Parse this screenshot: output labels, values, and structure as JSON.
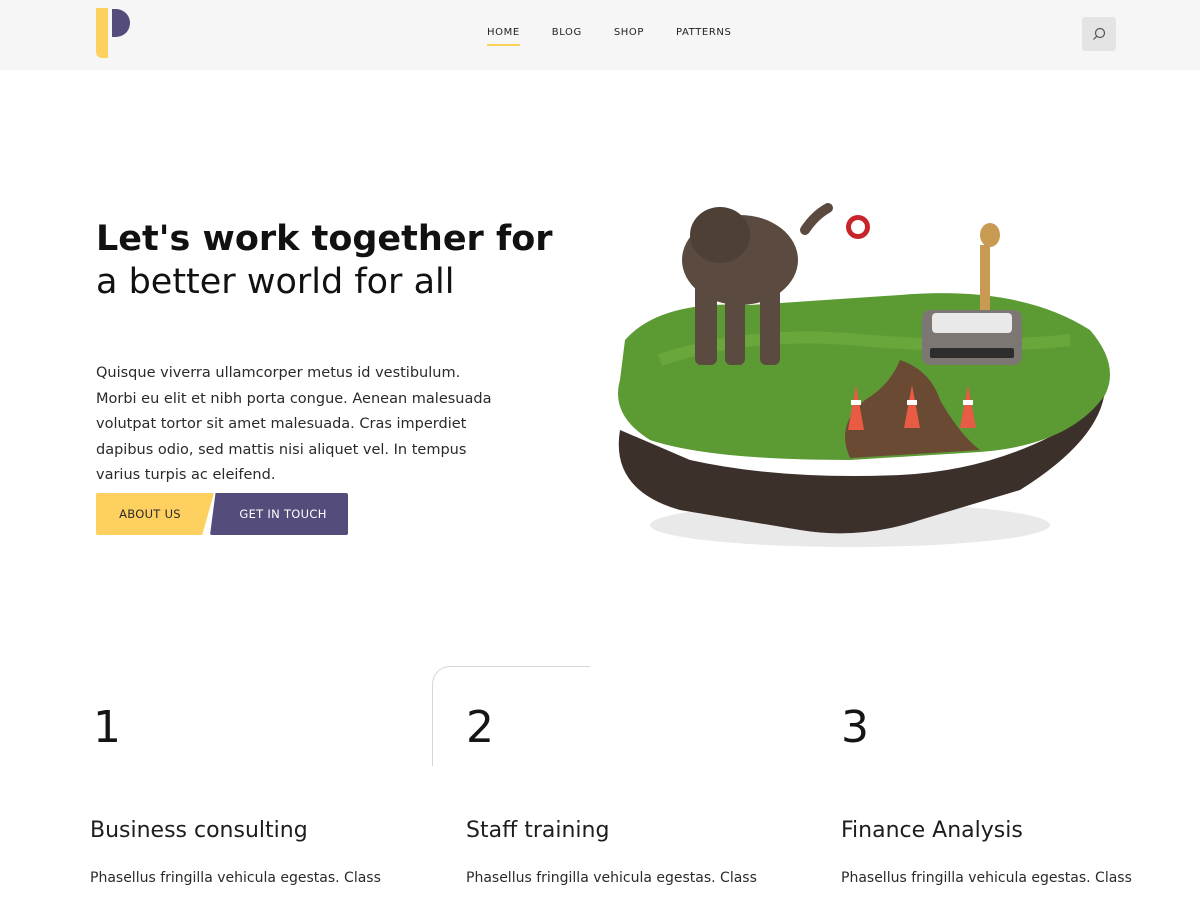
{
  "header": {
    "logo_icon": "brand-logo",
    "nav": [
      {
        "label": "HOME",
        "active": true
      },
      {
        "label": "BLOG",
        "active": false
      },
      {
        "label": "SHOP",
        "active": false
      },
      {
        "label": "PATTERNS",
        "active": false
      }
    ],
    "search_icon": "search-icon"
  },
  "hero": {
    "title_bold": "Let's work together for",
    "title_light": "a better world for all",
    "body": "Quisque viverra ullamcorper metus id vestibulum. Morbi eu elit et nibh porta congue. Aenean malesuada volutpat tortor sit amet malesuada. Cras imperdiet dapibus odio, sed mattis nisi aliquet vel. In tempus varius turpis ac eleifend.",
    "buttons": {
      "about": "ABOUT US",
      "touch": "GET IN TOUCH"
    },
    "image": "island-with-elephant-giraffe-car-and-traffic-cones"
  },
  "features": [
    {
      "number": "1",
      "title": "Business consulting",
      "text": "Phasellus fringilla vehicula egestas. Class"
    },
    {
      "number": "2",
      "title": "Staff training",
      "text": "Phasellus fringilla vehicula egestas. Class"
    },
    {
      "number": "3",
      "title": "Finance Analysis",
      "text": "Phasellus fringilla vehicula egestas. Class"
    }
  ],
  "colors": {
    "accent_yellow": "#fdd05f",
    "accent_purple": "#544c7a",
    "header_bg": "#f6f6f6"
  }
}
